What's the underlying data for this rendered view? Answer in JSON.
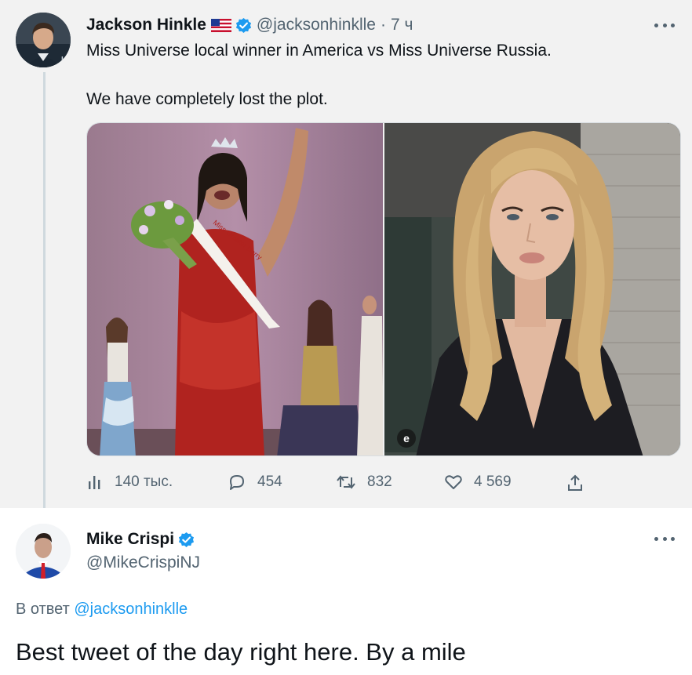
{
  "tweet": {
    "author_name": "Jackson Hinkle",
    "author_handle": "@jacksonhinklle",
    "separator": "·",
    "time": "7 ч",
    "text_line1": "Miss Universe local winner in America vs Miss Universe Russia.",
    "text_line2": "We have completely lost the plot.",
    "media": {
      "left_sash_text": "Miss Greater Derry",
      "right_badge": "e"
    },
    "stats": {
      "views": "140 тыс.",
      "replies": "454",
      "retweets": "832",
      "likes": "4 569"
    },
    "icons": [
      "flag-us-icon",
      "verified-badge-icon",
      "more-icon",
      "views-icon",
      "reply-icon",
      "retweet-icon",
      "like-icon",
      "share-icon"
    ]
  },
  "reply": {
    "author_name": "Mike Crispi",
    "author_handle": "@MikeCrispiNJ",
    "reply_prefix": "В ответ",
    "reply_mention": "@jacksonhinklle",
    "text": "Best tweet of the day right here. By a mile",
    "icons": [
      "verified-badge-icon",
      "more-icon"
    ]
  },
  "colors": {
    "accent": "#1d9bf0",
    "muted": "#536471",
    "text": "#0f1419",
    "tweet_bg": "#f2f2f2",
    "reply_bg": "#ffffff"
  }
}
